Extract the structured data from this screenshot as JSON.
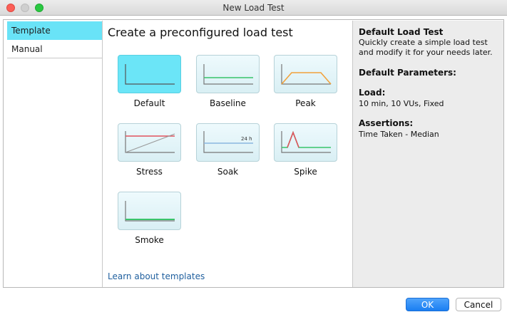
{
  "window": {
    "title": "New Load Test"
  },
  "sidebar": {
    "items": [
      {
        "label": "Template"
      },
      {
        "label": "Manual"
      }
    ]
  },
  "main": {
    "heading": "Create a preconfigured load test",
    "templates": [
      {
        "label": "Default"
      },
      {
        "label": "Baseline"
      },
      {
        "label": "Peak"
      },
      {
        "label": "Stress"
      },
      {
        "label": "Soak",
        "badge": "24 h"
      },
      {
        "label": "Spike"
      },
      {
        "label": "Smoke"
      }
    ],
    "learn_link": "Learn about templates"
  },
  "details": {
    "title": "Default Load Test",
    "description_line1": "Quickly create a simple load test",
    "description_line2": "and modify it for your needs later.",
    "params_heading": "Default Parameters:",
    "load_heading": "Load:",
    "load_value": "10 min, 10 VUs, Fixed",
    "assertions_heading": "Assertions:",
    "assertions_value": "Time Taken - Median"
  },
  "buttons": {
    "ok": "OK",
    "cancel": "Cancel"
  },
  "colors": {
    "selected": "#69e3f7",
    "green_line": "#39c46a",
    "orange_line": "#f2a23b",
    "red_line": "#e2525c",
    "blue_line": "#8ab7e0",
    "ok_button": "#1a7ef2"
  }
}
